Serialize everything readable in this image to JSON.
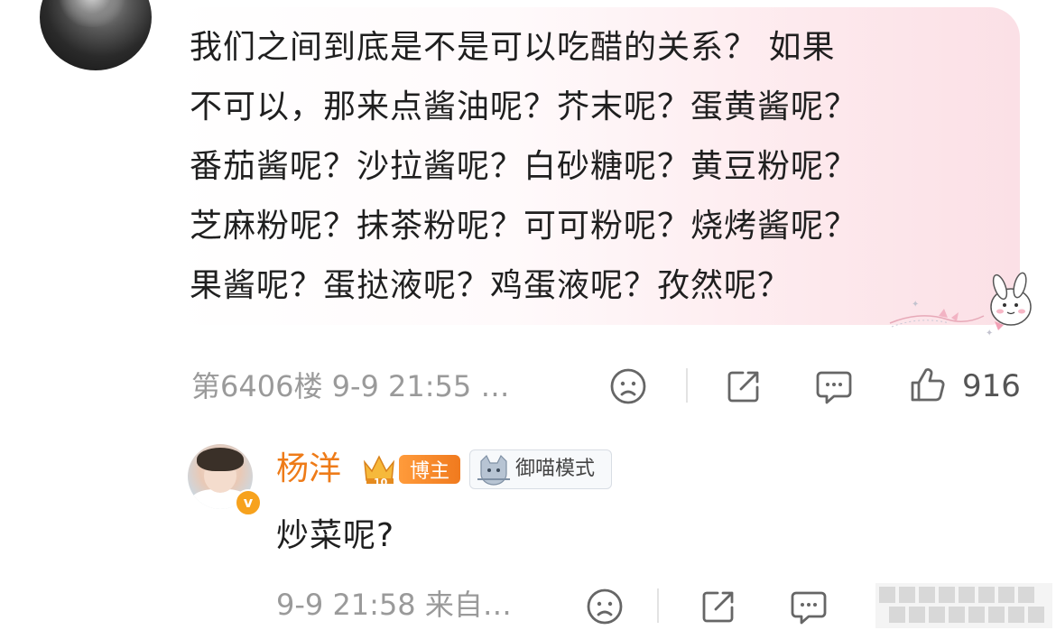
{
  "comment": {
    "lines": [
      "我们之间到底是不是可以吃醋的关系？ 如果",
      "不可以，那来点酱油呢？芥末呢？蛋黄酱呢？",
      "番茄酱呢？沙拉酱呢？白砂糖呢？黄豆粉呢？",
      "芝麻粉呢？抹茶粉呢？可可粉呢？烧烤酱呢？",
      "果酱呢？蛋挞液呢？鸡蛋液呢？孜然呢？"
    ],
    "meta": "第6406楼 9-9 21:55 …",
    "likes": "916",
    "icons": [
      "dislike-face-icon",
      "share-icon",
      "comment-icon",
      "thumbs-up-icon"
    ]
  },
  "reply": {
    "username": "杨洋",
    "host_badge": "博主",
    "host_level": "10",
    "mode_badge": "御喵模式",
    "verified_mark": "v",
    "text": "炒菜呢?",
    "meta": "9-9 21:58 来自…",
    "likes": "🔒"
  },
  "colors": {
    "username": "#ee7b18",
    "meta": "#9a9a9a",
    "bubble_pink": "#fbe0e6",
    "badge_orange": "#f07a1e"
  }
}
